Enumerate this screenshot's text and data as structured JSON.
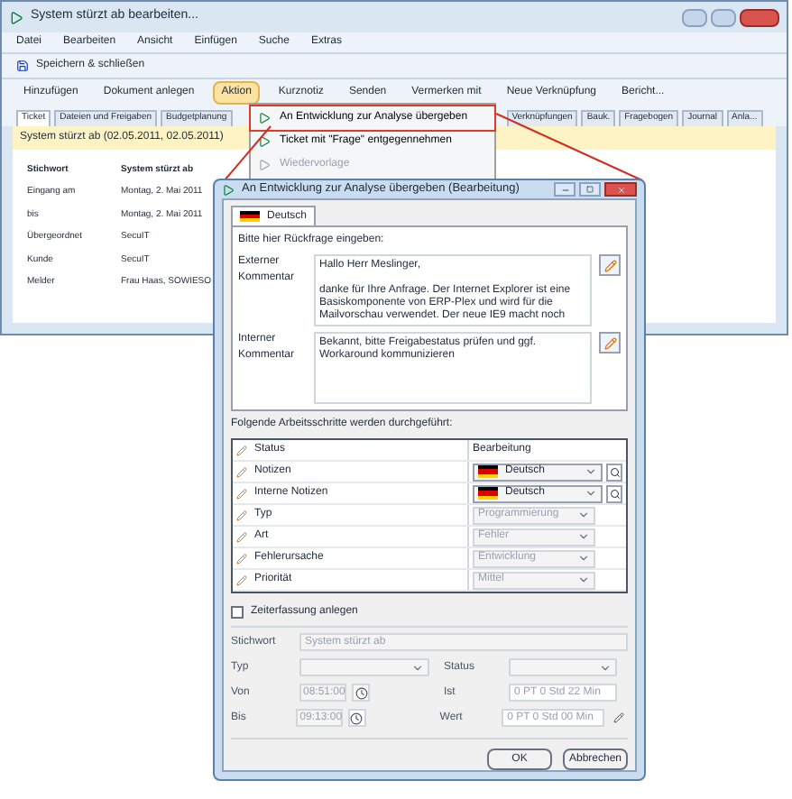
{
  "main_window": {
    "title": "System stürzt ab bearbeiten...",
    "menu": [
      "Datei",
      "Bearbeiten",
      "Ansicht",
      "Einfügen",
      "Suche",
      "Extras"
    ],
    "toolbar": [
      {
        "label": "Speichern & schließen"
      }
    ],
    "action_bar": [
      {
        "label": "Hinzufügen",
        "selected": false
      },
      {
        "label": "Dokument anlegen",
        "selected": false
      },
      {
        "label": "Aktion",
        "selected": true
      },
      {
        "label": "Kurznotiz",
        "selected": false
      },
      {
        "label": "Senden",
        "selected": false
      },
      {
        "label": "Vermerken mit",
        "selected": false
      },
      {
        "label": "Neue Verknüpfung",
        "selected": false
      },
      {
        "label": "Bericht...",
        "selected": false
      }
    ],
    "tabs": [
      {
        "label": "Ticket",
        "selected": true
      },
      {
        "label": "Dateien und Freigaben",
        "selected": false
      },
      {
        "label": "Budgetplanung",
        "selected": false
      },
      {
        "label": "Verknüpfungen",
        "selected": false
      },
      {
        "label": "Bauk.",
        "selected": false
      },
      {
        "label": "Fragebogen",
        "selected": false
      },
      {
        "label": "Journal",
        "selected": false
      },
      {
        "label": "Anla...",
        "selected": false
      }
    ],
    "info_bar": "System stürzt ab (02.05.2011, 02.05.2011)",
    "fields": [
      {
        "label": "Stichwort",
        "value": "System stürzt ab",
        "bold": true
      },
      {
        "label": "Eingang am",
        "value": "Montag, 2. Mai 2011",
        "bold": false
      },
      {
        "label": "bis",
        "value": "Montag, 2. Mai 2011",
        "bold": false
      },
      {
        "label": "Übergeordnet",
        "value": "SecuIT",
        "bold": false
      },
      {
        "label": "Kunde",
        "value": "SecuIT",
        "bold": false
      },
      {
        "label": "Melder",
        "value": "Frau Haas, SOWIESO",
        "bold": false
      }
    ]
  },
  "action_menu": [
    {
      "label": "An Entwicklung zur Analyse übergeben",
      "disabled": false,
      "selected": true
    },
    {
      "label": "Ticket mit \"Frage\" entgegennehmen",
      "disabled": false,
      "selected": false
    },
    {
      "label": "Wiedervorlage",
      "disabled": true,
      "selected": false
    }
  ],
  "dialog": {
    "title": "An Entwicklung zur Analyse übergeben (Bearbeitung)",
    "language_tab": "Deutsch",
    "prompt": "Bitte hier Rückfrage eingeben:",
    "comments": [
      {
        "label": "Externer Kommentar",
        "text": "Hallo Herr Meslinger,\n\ndanke für Ihre Anfrage. Der Internet Explorer ist eine Basiskomponente von ERP-Plex und wird für die Mailvorschau verwendet. Der neue IE9 macht noch"
      },
      {
        "label": "Interner Kommentar",
        "text": "Bekannt, bitte Freigabestatus prüfen und ggf. Workaround kommunizieren"
      }
    ],
    "steps_caption": "Folgende Arbeitsschritte werden durchgeführt:",
    "steps": [
      {
        "kind": "text",
        "name": "Status",
        "value": "Bearbeitung"
      },
      {
        "kind": "language",
        "name": "Notizen",
        "value": "Deutsch"
      },
      {
        "kind": "language",
        "name": "Interne Notizen",
        "value": "Deutsch"
      },
      {
        "kind": "locked",
        "name": "Typ",
        "value": "Programmierung"
      },
      {
        "kind": "locked",
        "name": "Art",
        "value": "Fehler"
      },
      {
        "kind": "locked",
        "name": "Fehlerursache",
        "value": "Entwicklung"
      },
      {
        "kind": "locked",
        "name": "Priorität",
        "value": "Mittel"
      }
    ],
    "time_tracking": {
      "label": "Zeiterfassung anlegen",
      "checked": false,
      "stichwort_label": "Stichwort",
      "stichwort": "System stürzt ab",
      "typ_label": "Typ",
      "status_label": "Status",
      "von_label": "Von",
      "von": "08:51:00",
      "bis_label": "Bis",
      "bis": "09:13:00",
      "ist_label": "Ist",
      "ist": "0 PT 0 Std 22 Min",
      "wert_label": "Wert",
      "wert": "0 PT 0 Std 00 Min"
    },
    "buttons": [
      "OK",
      "Abbrechen"
    ]
  }
}
